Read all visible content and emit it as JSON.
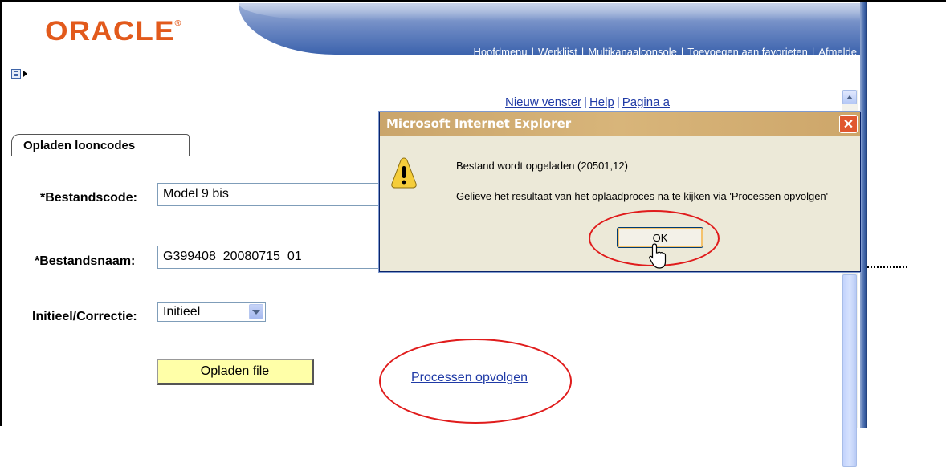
{
  "header": {
    "logo": "ORACLE",
    "nav": [
      "Hoofdmenu",
      "Werklijst",
      "Multikanaalconsole",
      "Toevoegen aan favorieten",
      "Afmelde"
    ],
    "page_links": [
      "Nieuw venster",
      "Help",
      "Pagina a"
    ]
  },
  "tab": {
    "label": "Opladen looncodes"
  },
  "form": {
    "bestandscode_label": "*Bestandscode:",
    "bestandscode_value": "Model 9 bis",
    "bestandsnaam_label": "*Bestandsnaam:",
    "bestandsnaam_value": "G399408_20080715_01",
    "initieel_label": "Initieel/Correctie:",
    "initieel_value": "Initieel",
    "upload_button": "Opladen file",
    "processen_link": "Processen opvolgen"
  },
  "dialog": {
    "title": "Microsoft Internet Explorer",
    "message1": "Bestand wordt opgeladen (20501,12)",
    "message2": "Gelieve het resultaat van het oplaadproces na te kijken via 'Processen opvolgen'",
    "ok_label": "OK"
  },
  "colors": {
    "brand": "#e25a1c",
    "banner": "#3c63ad",
    "link": "#1f3aa6",
    "highlight_ellipse": "#e01c1c",
    "button_yellow": "#ffffa8"
  },
  "icons": [
    "menu-toggle-icon",
    "warning-icon",
    "close-icon",
    "chevron-down-icon",
    "scroll-up-icon",
    "mouse-cursor-icon"
  ]
}
